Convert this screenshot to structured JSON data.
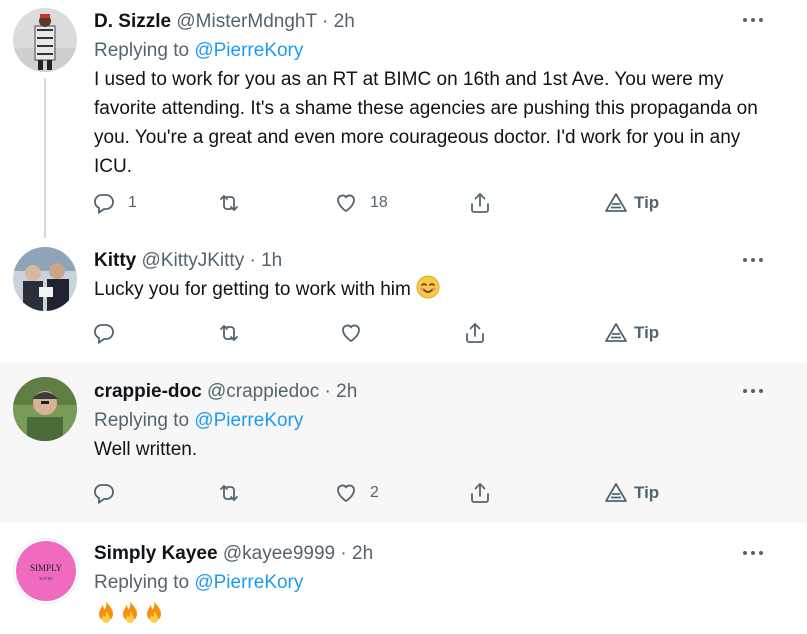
{
  "tweets": [
    {
      "name": "D. Sizzle",
      "handle": "@MisterMdnghT",
      "time": "2h",
      "replying_label": "Replying to",
      "replying_to": "@PierreKory",
      "text": "I used to work for you as an RT at BIMC on 16th and 1st Ave.  You were my favorite attending.   It's a shame these agencies are pushing this propaganda on you.    You're a great and even more courageous doctor.  I'd work for you in any ICU.",
      "replies": "1",
      "retweets": "",
      "likes": "18",
      "tip_label": "Tip"
    },
    {
      "name": "Kitty",
      "handle": "@KittyJKitty",
      "time": "1h",
      "text": "Lucky you for getting to work with him",
      "replies": "",
      "retweets": "",
      "likes": "",
      "tip_label": "Tip"
    },
    {
      "name": "crappie-doc",
      "handle": "@crappiedoc",
      "time": "2h",
      "replying_label": "Replying to",
      "replying_to": "@PierreKory",
      "text": "Well written.",
      "replies": "",
      "retweets": "",
      "likes": "2",
      "tip_label": "Tip"
    },
    {
      "name": "Simply Kayee",
      "handle": "@kayee9999",
      "time": "2h",
      "replying_label": "Replying to",
      "replying_to": "@PierreKory",
      "text": "",
      "avatar_text": "SIMPLY",
      "avatar_subtext": "KAYEE"
    }
  ],
  "dot": "·",
  "colors": {
    "accent": "#1d9bf0",
    "muted": "#536471",
    "highlight_bg": "#f7f7f7",
    "line": "#cfd9de"
  }
}
